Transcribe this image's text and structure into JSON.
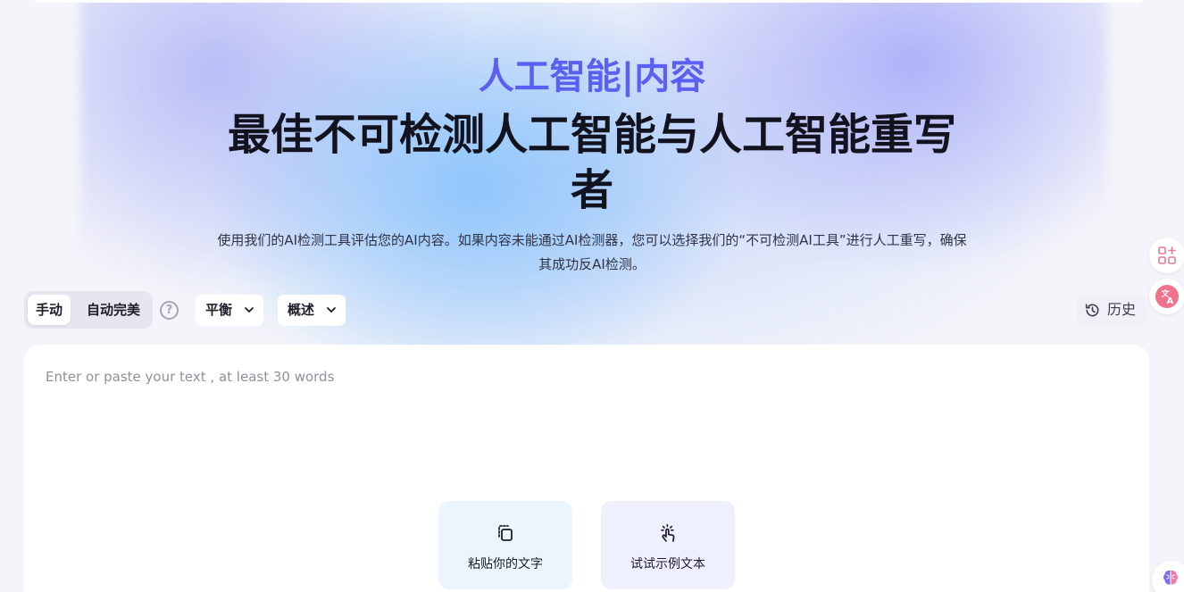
{
  "hero": {
    "kicker": "人工智能|内容",
    "title": "最佳不可检测人工智能与人工智能重写者",
    "subtitle": "使用我们的AI检测工具评估您的AI内容。如果内容未能通过AI检测器，您可以选择我们的“不可检测AI工具”进行人工重写，确保其成功反AI检测。"
  },
  "toolbar": {
    "modes": [
      {
        "label": "手动",
        "active": true
      },
      {
        "label": "自动完美",
        "active": false
      }
    ],
    "tone_dropdown": {
      "value": "平衡"
    },
    "type_dropdown": {
      "value": "概述"
    },
    "history_label": "历史"
  },
  "editor": {
    "placeholder": "Enter or paste your text , at least 30 words",
    "actions": [
      {
        "label": "粘贴你的文字",
        "icon": "paste-icon"
      },
      {
        "label": "试试示例文本",
        "icon": "pointer-click-icon"
      }
    ]
  },
  "side_tools": [
    {
      "icon": "apps-add-icon"
    },
    {
      "icon": "translate-icon"
    },
    {
      "icon": "brain-icon"
    }
  ],
  "colors": {
    "accent": "#5b5ff2",
    "page_bg": "#f4f5fa",
    "translate_badge": "#f0728b"
  }
}
